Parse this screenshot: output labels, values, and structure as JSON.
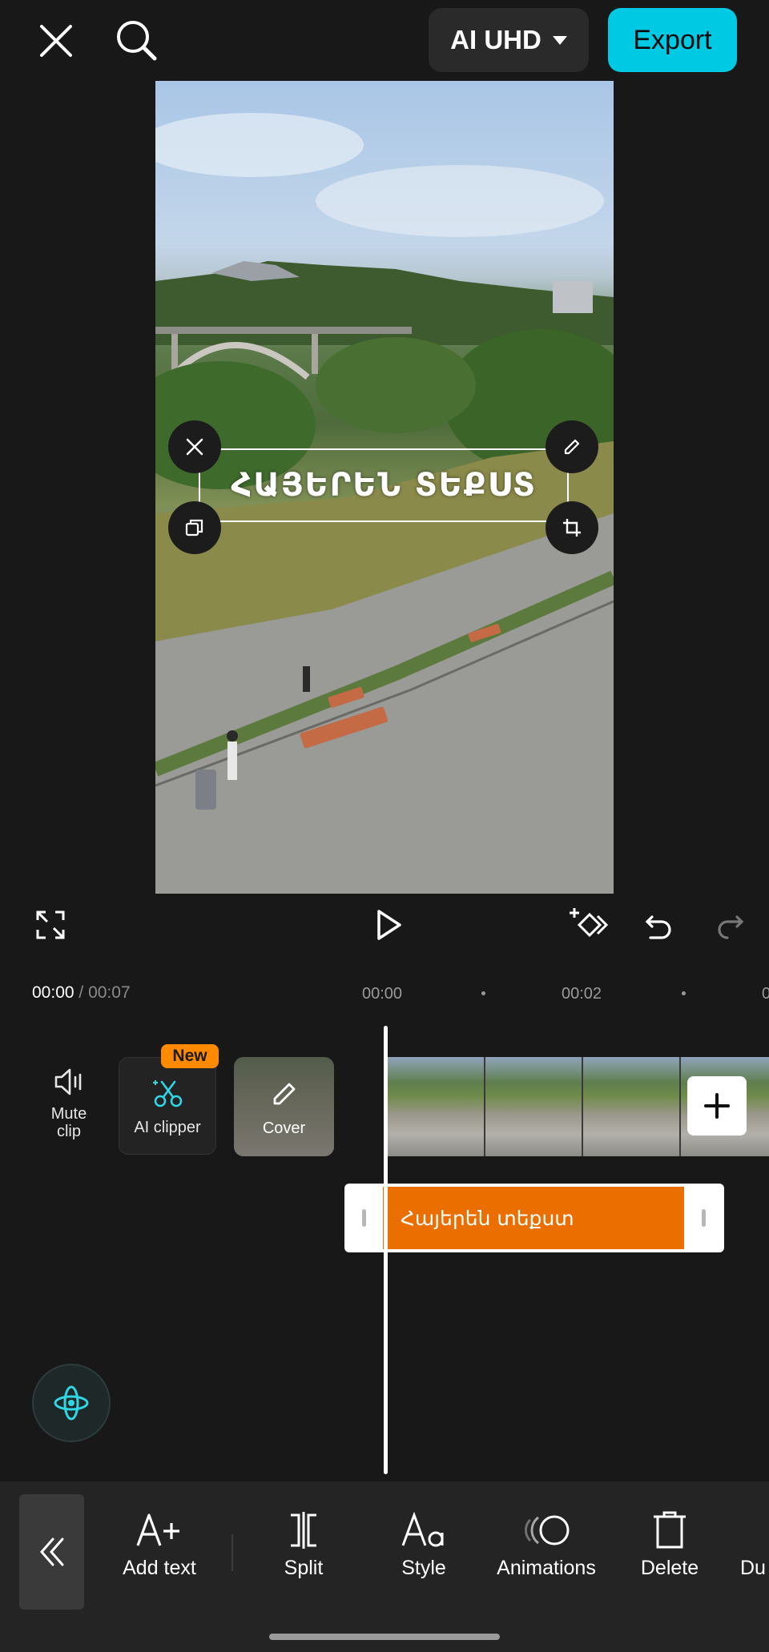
{
  "top_bar": {
    "close_icon": "close-icon",
    "search_icon": "search-icon",
    "quality_label": "AI UHD",
    "export_label": "Export"
  },
  "preview": {
    "overlay_text": "ՀԱՅԵՐԵՆ ՏԵՔՍՏ",
    "handles": [
      "close-icon",
      "edit-icon",
      "duplicate-icon",
      "rotate-scale-icon"
    ]
  },
  "controls": {
    "icons": [
      "fullscreen-icon",
      "play-icon",
      "keyframe-add-icon",
      "undo-icon",
      "redo-icon"
    ]
  },
  "time": {
    "current": "00:00",
    "total": " / 00:07",
    "ticks": [
      "00:00",
      "00:02",
      "0"
    ]
  },
  "timeline": {
    "mute_label": "Mute\nclip",
    "ai_clipper_label": "AI clipper",
    "new_badge": "New",
    "cover_label": "Cover",
    "text_track_label": "Հայերեն տեքստ"
  },
  "toolbar": {
    "items": [
      {
        "label": "Add text",
        "icon": "add-text-icon"
      },
      {
        "label": "Split",
        "icon": "split-icon"
      },
      {
        "label": "Style",
        "icon": "style-icon"
      },
      {
        "label": "Animations",
        "icon": "animations-icon"
      },
      {
        "label": "Delete",
        "icon": "delete-icon"
      },
      {
        "label": "Du",
        "icon": "duplicate-icon"
      }
    ]
  },
  "colors": {
    "accent": "#00c9e3",
    "text_track": "#ea6f00",
    "badge": "#ff8a00"
  }
}
